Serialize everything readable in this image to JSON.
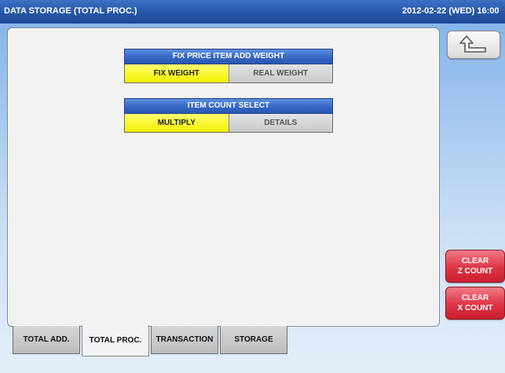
{
  "header": {
    "title": "DATA STORAGE (TOTAL PROC.)",
    "datetime": "2012-02-22 (WED) 16:00"
  },
  "groups": [
    {
      "title": "FIX PRICE ITEM ADD WEIGHT",
      "options": [
        {
          "label": "FIX WEIGHT",
          "selected": true
        },
        {
          "label": "REAL WEIGHT",
          "selected": false
        }
      ]
    },
    {
      "title": "ITEM COUNT SELECT",
      "options": [
        {
          "label": "MULTIPLY",
          "selected": true
        },
        {
          "label": "DETAILS",
          "selected": false
        }
      ]
    }
  ],
  "side_buttons": {
    "back_icon": "return-arrow-icon",
    "clear_z": {
      "line1": "CLEAR",
      "line2": "Z COUNT"
    },
    "clear_x": {
      "line1": "CLEAR",
      "line2": "X COUNT"
    }
  },
  "tabs": [
    {
      "label": "TOTAL ADD.",
      "active": false
    },
    {
      "label": "TOTAL PROC.",
      "active": true
    },
    {
      "label": "TRANSACTION",
      "active": false
    },
    {
      "label": "STORAGE",
      "active": false
    }
  ],
  "colors": {
    "selected": "#f3f000",
    "header_blue": "#3567c4",
    "clear_red": "#de3445"
  }
}
